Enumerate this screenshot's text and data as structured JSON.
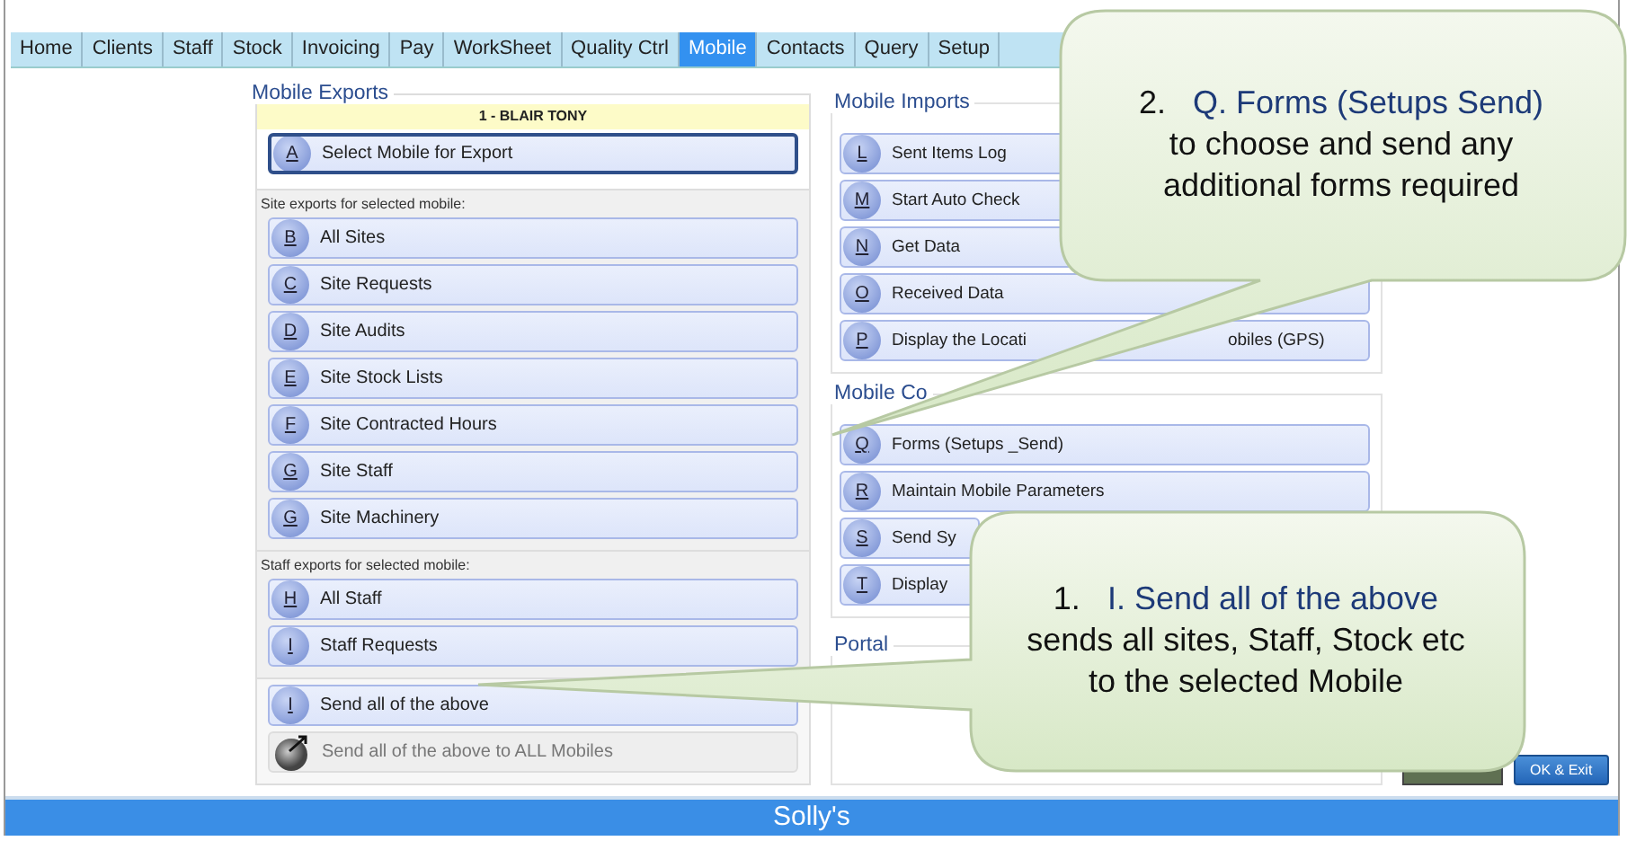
{
  "tabs": [
    {
      "label": "Home",
      "selected": false
    },
    {
      "label": "Clients",
      "selected": false
    },
    {
      "label": "Staff",
      "selected": false
    },
    {
      "label": "Stock",
      "selected": false
    },
    {
      "label": "Invoicing",
      "selected": false
    },
    {
      "label": "Pay",
      "selected": false
    },
    {
      "label": "WorkSheet",
      "selected": false
    },
    {
      "label": "Quality Ctrl",
      "selected": false
    },
    {
      "label": "Mobile",
      "selected": true
    },
    {
      "label": "Contacts",
      "selected": false
    },
    {
      "label": "Query",
      "selected": false
    },
    {
      "label": "Setup",
      "selected": false
    }
  ],
  "exports": {
    "title": "Mobile Exports",
    "selected_mobile": "1 - BLAIR TONY",
    "sections": [
      {
        "buttons": [
          {
            "key": "A",
            "label": "Select Mobile for Export",
            "kind": "primary",
            "disabled": false
          }
        ]
      },
      {
        "caption": "Site exports for selected mobile:",
        "buttons": [
          {
            "key": "B",
            "label": "All Sites",
            "kind": "normal",
            "disabled": false
          },
          {
            "key": "C",
            "label": "Site Requests",
            "kind": "normal",
            "disabled": false
          },
          {
            "key": "D",
            "label": "Site Audits",
            "kind": "normal",
            "disabled": false
          },
          {
            "key": "E",
            "label": "Site Stock Lists",
            "kind": "normal",
            "disabled": false
          },
          {
            "key": "F",
            "label": "Site Contracted Hours",
            "kind": "normal",
            "disabled": false
          },
          {
            "key": "G",
            "label": "Site Staff",
            "kind": "normal",
            "disabled": false
          },
          {
            "key": "G",
            "label": "Site Machinery",
            "kind": "normal",
            "disabled": false
          }
        ]
      },
      {
        "caption": "Staff exports for selected mobile:",
        "buttons": [
          {
            "key": "H",
            "label": "All Staff",
            "kind": "normal",
            "disabled": false
          },
          {
            "key": "I",
            "label": "Staff Requests",
            "kind": "normal",
            "disabled": false
          }
        ]
      },
      {
        "buttons": [
          {
            "key": "I",
            "label": "Send all of the above",
            "kind": "normal",
            "disabled": false
          },
          {
            "label": "Send all of the above to ALL Mobiles",
            "kind": "broadcast",
            "disabled": true
          }
        ]
      }
    ]
  },
  "groups": [
    {
      "title": "Mobile Imports",
      "buttons": [
        {
          "key": "L",
          "label": "Sent Items Log"
        },
        {
          "key": "M",
          "label": "Start Auto Check"
        },
        {
          "key": "N",
          "label": "Get Data"
        },
        {
          "key": "O",
          "label": "Received Data"
        },
        {
          "key": "P",
          "label": "Display the Locati",
          "label_end": "obiles (GPS)"
        }
      ]
    },
    {
      "title": "Mobile Co",
      "buttons": [
        {
          "key": "Q",
          "label": "Forms (Setups _Send)"
        },
        {
          "key": "R",
          "label": "Maintain Mobile Parameters"
        },
        {
          "key": "S",
          "label": "Send Sy"
        },
        {
          "key": "T",
          "label": "Display"
        }
      ]
    },
    {
      "title": "Portal"
    }
  ],
  "ok_button": "OK & Exit",
  "footer": "Solly's",
  "callouts": [
    {
      "number": "2.",
      "title": "Q. Forms (Setups Send)",
      "lines": [
        "to choose and send any",
        "additional forms required"
      ],
      "kind": "bottom"
    },
    {
      "number": "1.",
      "title": "I. Send all of the above",
      "lines": [
        "sends all sites, Staff, Stock etc",
        "to the selected Mobile"
      ],
      "kind": "left"
    }
  ]
}
